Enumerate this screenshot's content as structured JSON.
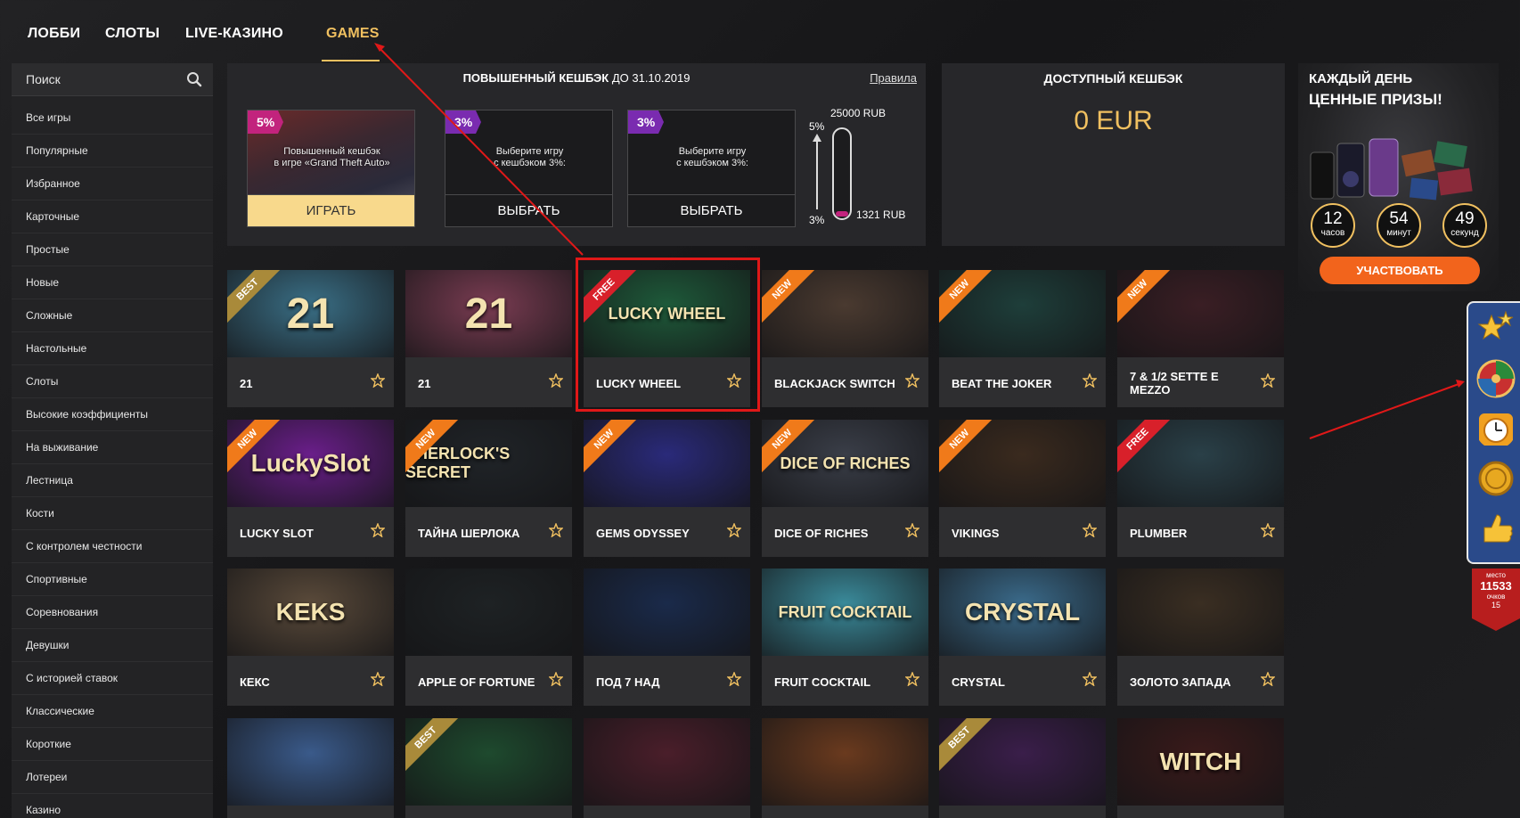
{
  "nav": {
    "items": [
      "ЛОББИ",
      "СЛОТЫ",
      "LIVE-КАЗИНО",
      "GAMES"
    ],
    "active": "GAMES"
  },
  "search": {
    "placeholder": "Поиск",
    "icon": "search-icon"
  },
  "sidebar": {
    "items": [
      "Все игры",
      "Популярные",
      "Избранное",
      "Карточные",
      "Простые",
      "Новые",
      "Сложные",
      "Настольные",
      "Слоты",
      "Высокие коэффициенты",
      "На выживание",
      "Лестница",
      "Кости",
      "С контролем честности",
      "Спортивные",
      "Соревнования",
      "Девушки",
      "С историей ставок",
      "Классические",
      "Короткие",
      "Лотереи",
      "Казино"
    ]
  },
  "cashback": {
    "title": "ПОВЫШЕННЫЙ КЕШБЭК",
    "until": "ДО 31.10.2019",
    "rules": "Правила",
    "cards": [
      {
        "pct": "5%",
        "desc_line1": "Повышенный кешбэк",
        "desc_line2": "в игре «Grand Theft Auto»",
        "button": "ИГРАТЬ"
      },
      {
        "pct": "3%",
        "desc_line1": "Выберите игру",
        "desc_line2": "с кешбэком 3%:",
        "button": "ВЫБРАТЬ"
      },
      {
        "pct": "3%",
        "desc_line1": "Выберите игру",
        "desc_line2": "с кешбэком 3%:",
        "button": "ВЫБРАТЬ"
      }
    ],
    "gauge": {
      "top_pct": "5%",
      "bottom_pct": "3%",
      "top_amount": "25000 RUB",
      "current_amount": "1321 RUB",
      "fill_fraction": 0.053
    }
  },
  "available": {
    "title": "ДОСТУПНЫЙ КЕШБЭК",
    "value": "0 EUR"
  },
  "promo": {
    "line1": "КАЖДЫЙ ДЕНЬ",
    "line2": "ЦЕННЫЕ ПРИЗЫ!",
    "timer": [
      {
        "n": "12",
        "u": "часов"
      },
      {
        "n": "54",
        "u": "минут"
      },
      {
        "n": "49",
        "u": "секунд"
      }
    ],
    "button": "УЧАСТВОВАТЬ"
  },
  "rank": {
    "label": "место",
    "place": "11533",
    "points_label": "очков",
    "points": "15"
  },
  "games": [
    {
      "name": "21",
      "badge": "BEST",
      "thumb_text": "21",
      "color": "#3a6f86"
    },
    {
      "name": "21",
      "badge": "",
      "thumb_text": "21",
      "color": "#7a3c52"
    },
    {
      "name": "LUCKY WHEEL",
      "badge": "FREE",
      "thumb_text": "LUCKY WHEEL",
      "color": "#1e5a3a"
    },
    {
      "name": "BLACKJACK SWITCH",
      "badge": "NEW",
      "thumb_text": "",
      "color": "#4a3a30"
    },
    {
      "name": "BEAT THE JOKER",
      "badge": "NEW",
      "thumb_text": "",
      "color": "#1e3e3a"
    },
    {
      "name": "7 & 1/2 SETTE E MEZZO",
      "badge": "NEW",
      "thumb_text": "",
      "color": "#3a1e24"
    },
    {
      "name": "LUCKY SLOT",
      "badge": "NEW",
      "thumb_text": "LuckySlot",
      "color": "#6a1e8a"
    },
    {
      "name": "ТАЙНА ШЕРЛОКА",
      "badge": "NEW",
      "thumb_text": "SHERLOCK'S SECRET",
      "color": "#202428"
    },
    {
      "name": "GEMS ODYSSEY",
      "badge": "NEW",
      "thumb_text": "",
      "color": "#2a2a7a"
    },
    {
      "name": "DICE OF RICHES",
      "badge": "NEW",
      "thumb_text": "DICE OF RICHES",
      "color": "#3a3e48"
    },
    {
      "name": "VIKINGS",
      "badge": "NEW",
      "thumb_text": "",
      "color": "#3a2a1e"
    },
    {
      "name": "PLUMBER",
      "badge": "FREE",
      "thumb_text": "",
      "color": "#2a4048"
    },
    {
      "name": "КЕКС",
      "badge": "",
      "thumb_text": "KEKS",
      "color": "#5a4a3a"
    },
    {
      "name": "APPLE OF FORTUNE",
      "badge": "",
      "thumb_text": "",
      "color": "#1e2224"
    },
    {
      "name": "ПОД 7 НАД",
      "badge": "",
      "thumb_text": "",
      "color": "#1a2a4a"
    },
    {
      "name": "FRUIT COCKTAIL",
      "badge": "",
      "thumb_text": "FRUIT COCKTAIL",
      "color": "#3a8a9a"
    },
    {
      "name": "CRYSTAL",
      "badge": "",
      "thumb_text": "CRYSTAL",
      "color": "#3a6a8a"
    },
    {
      "name": "ЗОЛОТО ЗАПАДА",
      "badge": "",
      "thumb_text": "",
      "color": "#3a2e22"
    },
    {
      "name": "",
      "badge": "",
      "thumb_text": "",
      "color": "#3a5a8a"
    },
    {
      "name": "",
      "badge": "BEST",
      "thumb_text": "",
      "color": "#1e4a2e"
    },
    {
      "name": "",
      "badge": "",
      "thumb_text": "",
      "color": "#4a1e2a"
    },
    {
      "name": "",
      "badge": "",
      "thumb_text": "",
      "color": "#6a3a1e"
    },
    {
      "name": "",
      "badge": "BEST",
      "thumb_text": "",
      "color": "#3a1e4a"
    },
    {
      "name": "",
      "badge": "",
      "thumb_text": "WITCH",
      "color": "#3a1a1a"
    }
  ]
}
